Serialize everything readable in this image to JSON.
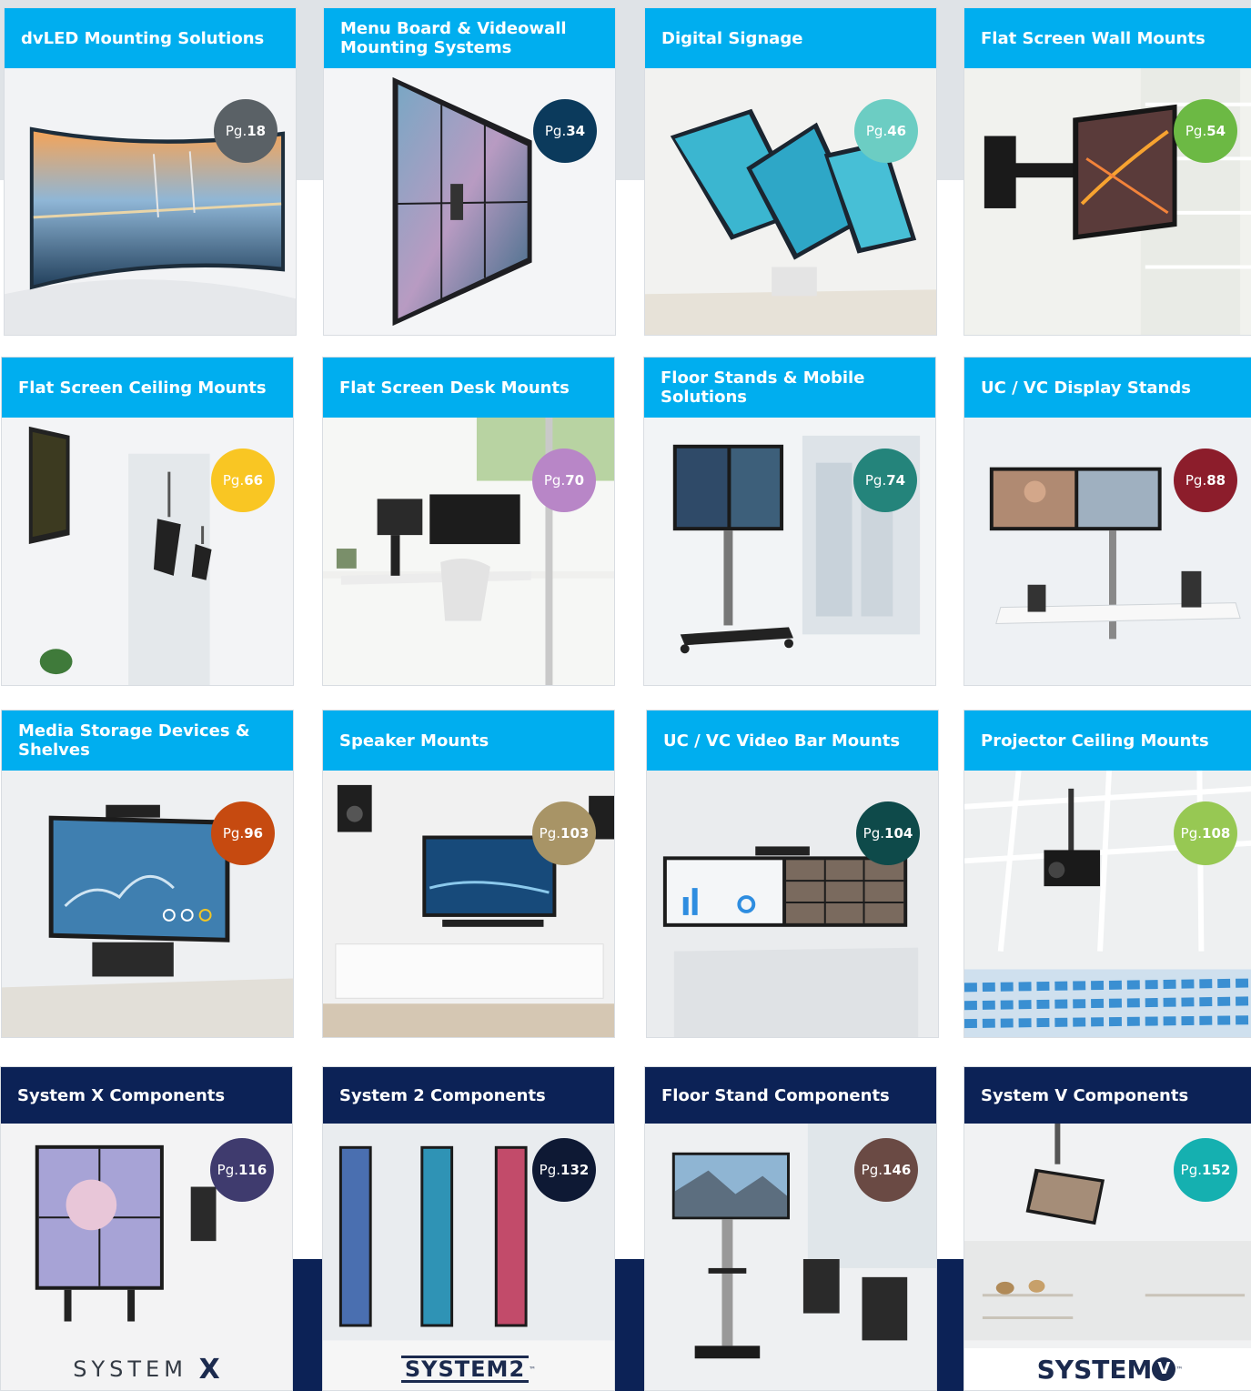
{
  "colors": {
    "tile_header_blue": "#00aeef",
    "tile_header_navy": "#0c2256",
    "band_gray": "#dfe3e7",
    "band_navy": "#0c2256"
  },
  "tiles": [
    {
      "title": "dvLED Mounting Solutions",
      "pg_prefix": "Pg.",
      "page": "18",
      "badge_color": "#5a6166"
    },
    {
      "title": "Menu Board & Videowall Mounting Systems",
      "pg_prefix": "Pg.",
      "page": "34",
      "badge_color": "#0b3a5c"
    },
    {
      "title": "Digital Signage",
      "pg_prefix": "Pg.",
      "page": "46",
      "badge_color": "#6ccdc3"
    },
    {
      "title": "Flat Screen Wall Mounts",
      "pg_prefix": "Pg.",
      "page": "54",
      "badge_color": "#6cb944"
    },
    {
      "title": "Flat Screen Ceiling Mounts",
      "pg_prefix": "Pg.",
      "page": "66",
      "badge_color": "#f9c623"
    },
    {
      "title": "Flat Screen Desk Mounts",
      "pg_prefix": "Pg.",
      "page": "70",
      "badge_color": "#b886c7"
    },
    {
      "title": "Floor Stands & Mobile Solutions",
      "pg_prefix": "Pg.",
      "page": "74",
      "badge_color": "#24847b"
    },
    {
      "title": "UC / VC Display Stands",
      "pg_prefix": "Pg.",
      "page": "88",
      "badge_color": "#8c1d2b"
    },
    {
      "title": "Media Storage Devices & Shelves",
      "pg_prefix": "Pg.",
      "page": "96",
      "badge_color": "#c64a10"
    },
    {
      "title": "Speaker Mounts",
      "pg_prefix": "Pg.",
      "page": "103",
      "badge_color": "#a89466"
    },
    {
      "title": "UC / VC Video Bar Mounts",
      "pg_prefix": "Pg.",
      "page": "104",
      "badge_color": "#0e4a4a"
    },
    {
      "title": "Projector Ceiling Mounts",
      "pg_prefix": "Pg.",
      "page": "108",
      "badge_color": "#97c853"
    },
    {
      "title": "System X Components",
      "pg_prefix": "Pg.",
      "page": "116",
      "badge_color": "#3f3b6e"
    },
    {
      "title": "System 2 Components",
      "pg_prefix": "Pg.",
      "page": "132",
      "badge_color": "#0e1934"
    },
    {
      "title": "Floor Stand Components",
      "pg_prefix": "Pg.",
      "page": "146",
      "badge_color": "#6a4a44"
    },
    {
      "title": "System V Components",
      "pg_prefix": "Pg.",
      "page": "152",
      "badge_color": "#15b0b0"
    }
  ],
  "logos": {
    "system_x": {
      "word": "SYSTEM",
      "mark": "X"
    },
    "system_2": {
      "word": "SYSTEM",
      "mark": "2",
      "tm": "™"
    },
    "system_v": {
      "word": "SYSTEM",
      "mark": "V",
      "tm": "™"
    }
  }
}
